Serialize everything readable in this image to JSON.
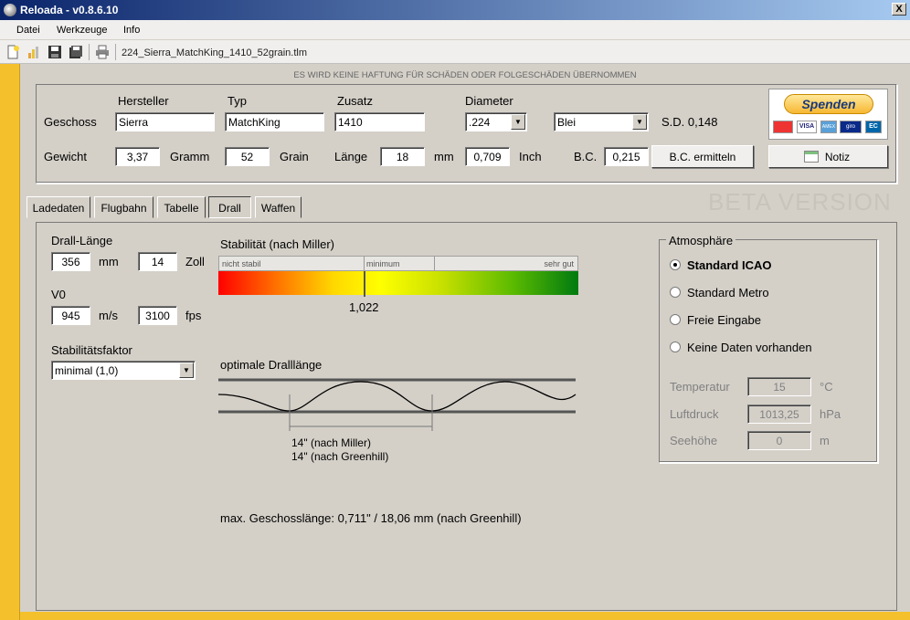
{
  "window": {
    "title": "Reloada - v0.8.6.10",
    "close": "X"
  },
  "menu": [
    "Datei",
    "Werkzeuge",
    "Info"
  ],
  "toolbar": {
    "filename": "224_Sierra_MatchKing_1410_52grain.tlm"
  },
  "disclaimer": "ES WIRD KEINE HAFTUNG FÜR SCHÄDEN ODER FOLGESCHÄDEN ÜBERNOMMEN",
  "geschoss": {
    "hersteller_label": "Hersteller",
    "typ_label": "Typ",
    "zusatz_label": "Zusatz",
    "diameter_label": "Diameter",
    "row_label": "Geschoss",
    "hersteller": "Sierra",
    "typ": "MatchKing",
    "zusatz": "1410",
    "diameter": ".224",
    "material": "Blei",
    "sd_label": "S.D. 0,148",
    "gewicht_label": "Gewicht",
    "gewicht": "3,37",
    "gramm_label": "Gramm",
    "grain": "52",
    "grain_label": "Grain",
    "laenge_label": "Länge",
    "laenge_mm": "18",
    "mm_label": "mm",
    "laenge_inch": "0,709",
    "inch_label": "Inch",
    "bc_label": "B.C.",
    "bc": "0,215",
    "bc_button": "B.C. ermitteln"
  },
  "spenden": {
    "label": "Spenden",
    "cards": [
      "VISA",
      "AMEX",
      "giro",
      "EC"
    ]
  },
  "notiz_button": "Notiz",
  "beta": "BETA VERSION",
  "tabs": [
    "Ladedaten",
    "Flugbahn",
    "Tabelle",
    "Drall",
    "Waffen"
  ],
  "drall": {
    "laenge_label": "Drall-Länge",
    "laenge_mm": "356",
    "mm_label": "mm",
    "laenge_zoll": "14",
    "zoll_label": "Zoll",
    "v0_label": "V0",
    "v0_ms": "945",
    "ms_label": "m/s",
    "v0_fps": "3100",
    "fps_label": "fps",
    "stabfaktor_label": "Stabilitätsfaktor",
    "stabfaktor": "minimal (1,0)",
    "stab_title": "Stabilität (nach Miller)",
    "scale_labels": [
      "nicht stabil",
      "minimum",
      "sehr gut"
    ],
    "stab_value": "1,022",
    "optimal_title": "optimale Dralllänge",
    "miller": "14\" (nach Miller)",
    "greenhill": "14\" (nach Greenhill)",
    "max_laenge": "max. Geschosslänge: 0,711\" / 18,06 mm (nach Greenhill)"
  },
  "atmo": {
    "title": "Atmosphäre",
    "options": [
      "Standard ICAO",
      "Standard Metro",
      "Freie Eingabe",
      "Keine Daten vorhanden"
    ],
    "temp_label": "Temperatur",
    "temp": "15",
    "temp_unit": "°C",
    "druck_label": "Luftdruck",
    "druck": "1013,25",
    "druck_unit": "hPa",
    "hoehe_label": "Seehöhe",
    "hoehe": "0",
    "hoehe_unit": "m"
  }
}
